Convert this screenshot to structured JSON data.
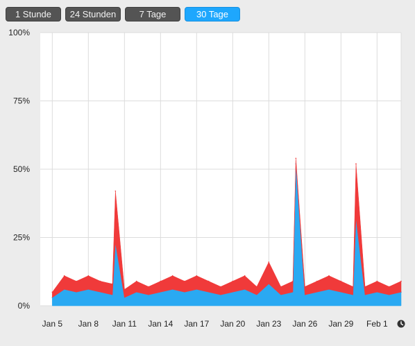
{
  "range_buttons": [
    {
      "label": "1 Stunde",
      "active": false
    },
    {
      "label": "24 Stunden",
      "active": false
    },
    {
      "label": "7 Tage",
      "active": false
    },
    {
      "label": "30 Tage",
      "active": true
    }
  ],
  "clock_icon": "clock-icon",
  "colors": {
    "user": "#2aa9f2",
    "system": "#f03a3a",
    "grid": "#dcdcdc",
    "plot_bg": "#ffffff",
    "active_button": "#1ea7fd",
    "inactive_button": "#545454"
  },
  "chart_data": {
    "type": "area",
    "stacked": true,
    "title": "",
    "xlabel": "",
    "ylabel": "",
    "x_range": [
      "2025-01-04",
      "2025-02-03"
    ],
    "ylim": [
      0,
      100
    ],
    "y_ticks": [
      {
        "value": 0,
        "label": "0%"
      },
      {
        "value": 25,
        "label": "25%"
      },
      {
        "value": 50,
        "label": "50%"
      },
      {
        "value": 75,
        "label": "75%"
      },
      {
        "value": 100,
        "label": "100%"
      }
    ],
    "x_ticks": [
      {
        "date": "2025-01-05",
        "label": "Jan 5"
      },
      {
        "date": "2025-01-08",
        "label": "Jan 8"
      },
      {
        "date": "2025-01-11",
        "label": "Jan 11"
      },
      {
        "date": "2025-01-14",
        "label": "Jan 14"
      },
      {
        "date": "2025-01-17",
        "label": "Jan 17"
      },
      {
        "date": "2025-01-20",
        "label": "Jan 20"
      },
      {
        "date": "2025-01-23",
        "label": "Jan 23"
      },
      {
        "date": "2025-01-26",
        "label": "Jan 26"
      },
      {
        "date": "2025-01-29",
        "label": "Jan 29"
      },
      {
        "date": "2025-02-01",
        "label": "Feb 1"
      }
    ],
    "grid": true,
    "legend": "none",
    "series": [
      {
        "color": "#2aa9f2",
        "x": [
          "2025-01-05",
          "2025-01-06",
          "2025-01-07",
          "2025-01-08",
          "2025-01-09",
          "2025-01-10",
          "2025-01-10T06:00",
          "2025-01-11",
          "2025-01-12",
          "2025-01-13",
          "2025-01-14",
          "2025-01-15",
          "2025-01-16",
          "2025-01-17",
          "2025-01-18",
          "2025-01-19",
          "2025-01-20",
          "2025-01-21",
          "2025-01-22",
          "2025-01-23",
          "2025-01-24",
          "2025-01-25",
          "2025-01-25T06:00",
          "2025-01-26",
          "2025-01-27",
          "2025-01-28",
          "2025-01-29",
          "2025-01-30",
          "2025-01-30T06:00",
          "2025-01-31",
          "2025-02-01",
          "2025-02-02",
          "2025-02-03"
        ],
        "values": [
          3,
          6,
          5,
          6,
          5,
          4,
          23,
          3,
          5,
          4,
          5,
          6,
          5,
          6,
          5,
          4,
          5,
          6,
          4,
          8,
          4,
          5,
          52,
          4,
          5,
          6,
          5,
          4,
          32,
          4,
          5,
          4,
          5
        ]
      },
      {
        "color": "#f03a3a",
        "x": [
          "2025-01-05",
          "2025-01-06",
          "2025-01-07",
          "2025-01-08",
          "2025-01-09",
          "2025-01-10",
          "2025-01-10T06:00",
          "2025-01-11",
          "2025-01-12",
          "2025-01-13",
          "2025-01-14",
          "2025-01-15",
          "2025-01-16",
          "2025-01-17",
          "2025-01-18",
          "2025-01-19",
          "2025-01-20",
          "2025-01-21",
          "2025-01-22",
          "2025-01-23",
          "2025-01-24",
          "2025-01-25",
          "2025-01-25T06:00",
          "2025-01-26",
          "2025-01-27",
          "2025-01-28",
          "2025-01-29",
          "2025-01-30",
          "2025-01-30T06:00",
          "2025-01-31",
          "2025-02-01",
          "2025-02-02",
          "2025-02-03"
        ],
        "values": [
          2,
          5,
          4,
          5,
          4,
          4,
          19,
          3,
          4,
          3,
          4,
          5,
          4,
          5,
          4,
          3,
          4,
          5,
          3,
          8,
          3,
          4,
          2,
          3,
          4,
          5,
          4,
          3,
          20,
          3,
          4,
          3,
          4
        ]
      }
    ]
  }
}
